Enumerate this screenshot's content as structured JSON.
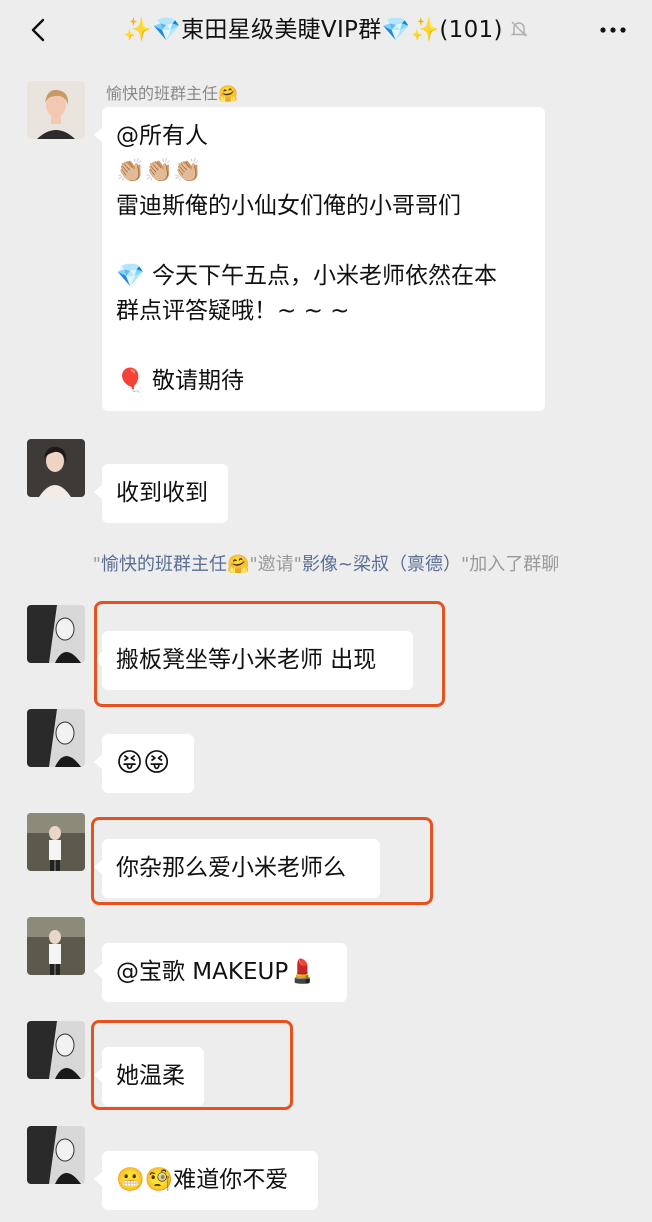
{
  "header": {
    "title": "✨💎東田星级美睫VIP群💎✨(101)",
    "mute_icon": "bell-slash-icon",
    "back_icon": "chevron-left-icon",
    "more_icon": "more-dots-icon"
  },
  "messages": [
    {
      "sender": "愉快的班群主任🤗",
      "lines": [
        "@所有人",
        "👏🏼👏🏼👏🏼",
        "雷迪斯俺的小仙女们俺的小哥哥们",
        "",
        "💎 今天下午五点，小米老师依然在本",
        "群点评答疑哦！~ ~ ~",
        "",
        "🎈 敬请期待"
      ]
    },
    {
      "text": "收到收到"
    },
    {
      "text": "搬板凳坐等小米老师 出现"
    },
    {
      "text": "😝😝"
    },
    {
      "text": "你杂那么爱小米老师么"
    },
    {
      "text": "@宝歌 MAKEUP💄"
    },
    {
      "text": "她温柔"
    },
    {
      "text": "😬🧐难道你不爱"
    }
  ],
  "system_notice": {
    "q1": "\"",
    "inviter": "愉快的班群主任🤗",
    "q2": "\"邀请\"",
    "invitee": "影像~梁叔（禀德）",
    "q3": "\"加入了群聊"
  },
  "colors": {
    "background": "#ededed",
    "bubble": "#ffffff",
    "highlight": "#e6521f",
    "link_name": "#5a6d95"
  }
}
